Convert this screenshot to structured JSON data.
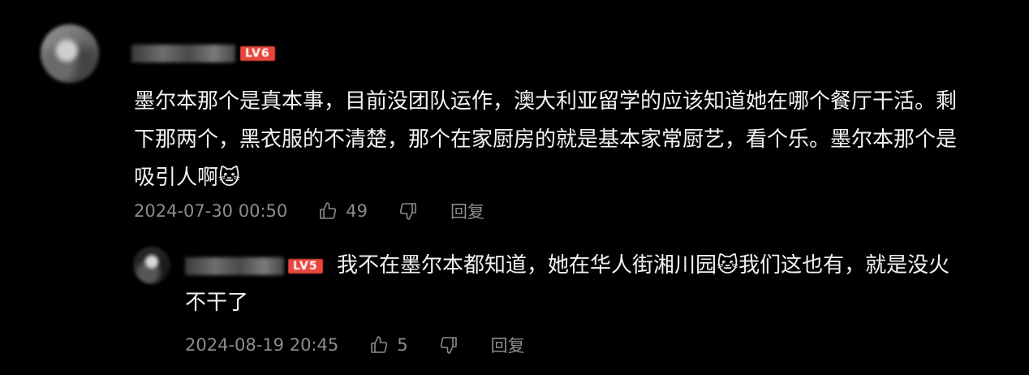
{
  "comment": {
    "level": "LV6",
    "text_line1": "墨尔本那个是真本事，目前没团队运作，澳大利亚留学的应该知道她在哪个餐厅干活。剩",
    "text_line2": "下那两个，黑衣服的不清楚，那个在家厨房的就是基本家常厨艺，看个乐。墨尔本那个是",
    "text_line3": "吸引人啊",
    "emoji": "🐱",
    "timestamp": "2024-07-30 00:50",
    "likes": "49",
    "reply_label": "回复",
    "icons": {
      "like": "thumbs-up-icon",
      "dislike": "thumbs-down-icon"
    }
  },
  "reply": {
    "level": "LV5",
    "text_part1": "我不在墨尔本都知道，她在华人街湘川园",
    "emoji": "🐱",
    "text_part2": "我们这也有，就是没火",
    "text_line2": "不干了",
    "timestamp": "2024-08-19 20:45",
    "likes": "5",
    "reply_label": "回复"
  }
}
